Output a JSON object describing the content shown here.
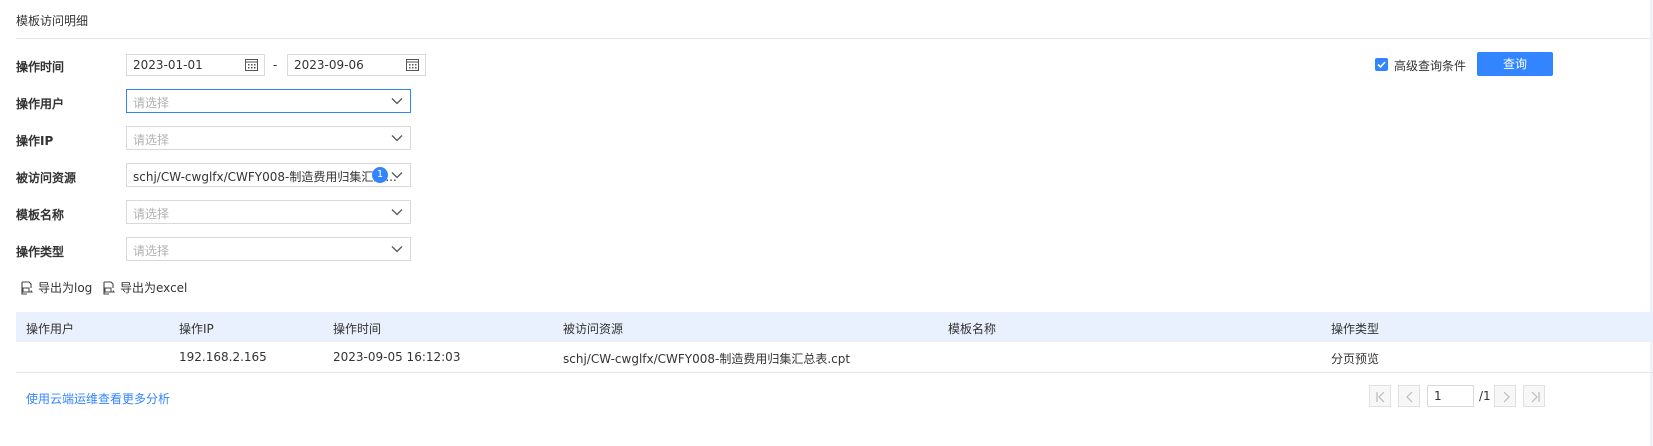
{
  "panel_title": "模板访问明细",
  "filters": {
    "time_label": "操作时间",
    "date_from": "2023-01-01",
    "date_sep": "-",
    "date_to": "2023-09-06",
    "user_label": "操作用户",
    "user_placeholder": "请选择",
    "ip_label": "操作IP",
    "ip_placeholder": "请选择",
    "resource_label": "被访问资源",
    "resource_value": "schj/CW-cwglfx/CWFY008-制造费用归集汇总...",
    "resource_count": "1",
    "template_label": "模板名称",
    "template_placeholder": "请选择",
    "type_label": "操作类型",
    "type_placeholder": "请选择",
    "advanced_label": "高级查询条件",
    "advanced_checked": true,
    "query_button": "查询"
  },
  "exports": {
    "log": "导出为log",
    "excel": "导出为excel"
  },
  "table": {
    "columns": [
      "操作用户",
      "操作IP",
      "操作时间",
      "被访问资源",
      "模板名称",
      "操作类型"
    ],
    "rows": [
      [
        "",
        "192.168.2.165",
        "2023-09-05 16:12:03",
        "schj/CW-cwglfx/CWFY008-制造费用归集汇总表.cpt",
        "",
        "分页预览"
      ]
    ]
  },
  "footer": {
    "cloud_link": "使用云端运维查看更多分析",
    "page_current": "1",
    "page_total": "/1"
  },
  "colors": {
    "accent": "#3385ff",
    "header_bg": "#e8f1fd"
  }
}
